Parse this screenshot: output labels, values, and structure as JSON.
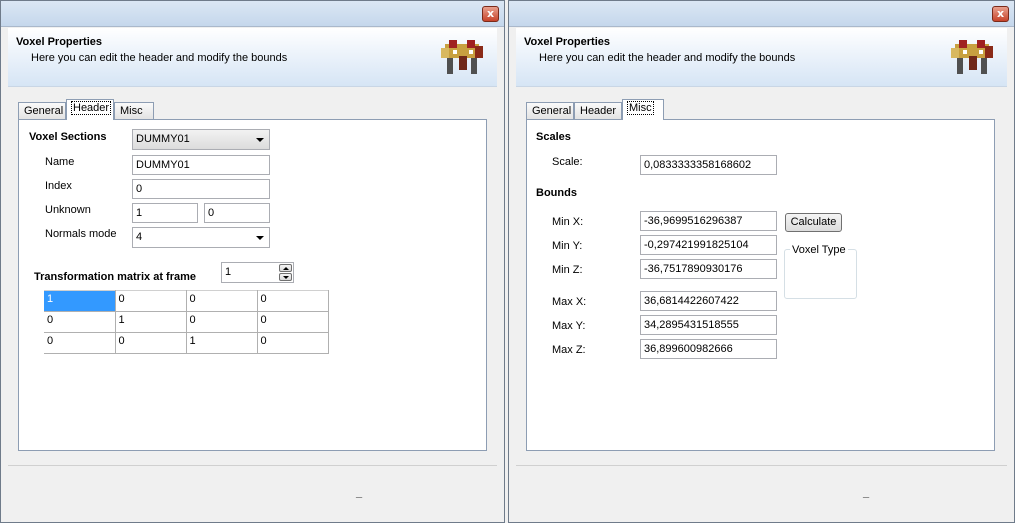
{
  "left_window": {
    "close_glyph": "x",
    "banner": {
      "title": "Voxel Properties",
      "subtitle": "Here you can edit the header and modify the bounds"
    },
    "tabs": [
      "General",
      "Header",
      "Misc"
    ],
    "active_tab": "Header",
    "header": {
      "voxel_sections_label": "Voxel Sections",
      "voxel_sections_value": "DUMMY01",
      "name_label": "Name",
      "name_value": "DUMMY01",
      "index_label": "Index",
      "index_value": "0",
      "unknown_label": "Unknown",
      "unknown_value_1": "1",
      "unknown_value_2": "0",
      "normals_label": "Normals mode",
      "normals_value": "4",
      "matrix_label": "Transformation matrix at frame",
      "frame_value": "1",
      "matrix": [
        [
          "1",
          "0",
          "0",
          "0"
        ],
        [
          "0",
          "1",
          "0",
          "0"
        ],
        [
          "0",
          "0",
          "1",
          "0"
        ]
      ]
    },
    "status_glyph": "_"
  },
  "right_window": {
    "close_glyph": "x",
    "banner": {
      "title": "Voxel Properties",
      "subtitle": "Here you can edit the header and modify the bounds"
    },
    "tabs": [
      "General",
      "Header",
      "Misc"
    ],
    "active_tab": "Misc",
    "misc": {
      "scales_heading": "Scales",
      "scale_label": "Scale:",
      "scale_value": "0,0833333358168602",
      "bounds_heading": "Bounds",
      "min_x_label": "Min X:",
      "min_x_value": "-36,9699516296387",
      "min_y_label": "Min Y:",
      "min_y_value": "-0,297421991825104",
      "min_z_label": "Min Z:",
      "min_z_value": "-36,7517890930176",
      "max_x_label": "Max X:",
      "max_x_value": "36,6814422607422",
      "max_y_label": "Max Y:",
      "max_y_value": "34,2895431518555",
      "max_z_label": "Max Z:",
      "max_z_value": "36,899600982666",
      "calculate_label": "Calculate",
      "voxel_type_label": "Voxel Type"
    },
    "status_glyph": "_"
  },
  "colors": {
    "selection": "#3399ff",
    "close_button": "#c7432a"
  },
  "icons": {
    "close": "close-icon",
    "logo": "voxel-logo-icon",
    "dropdown": "chevron-down-icon",
    "spinner": "spinner-arrows-icon"
  }
}
